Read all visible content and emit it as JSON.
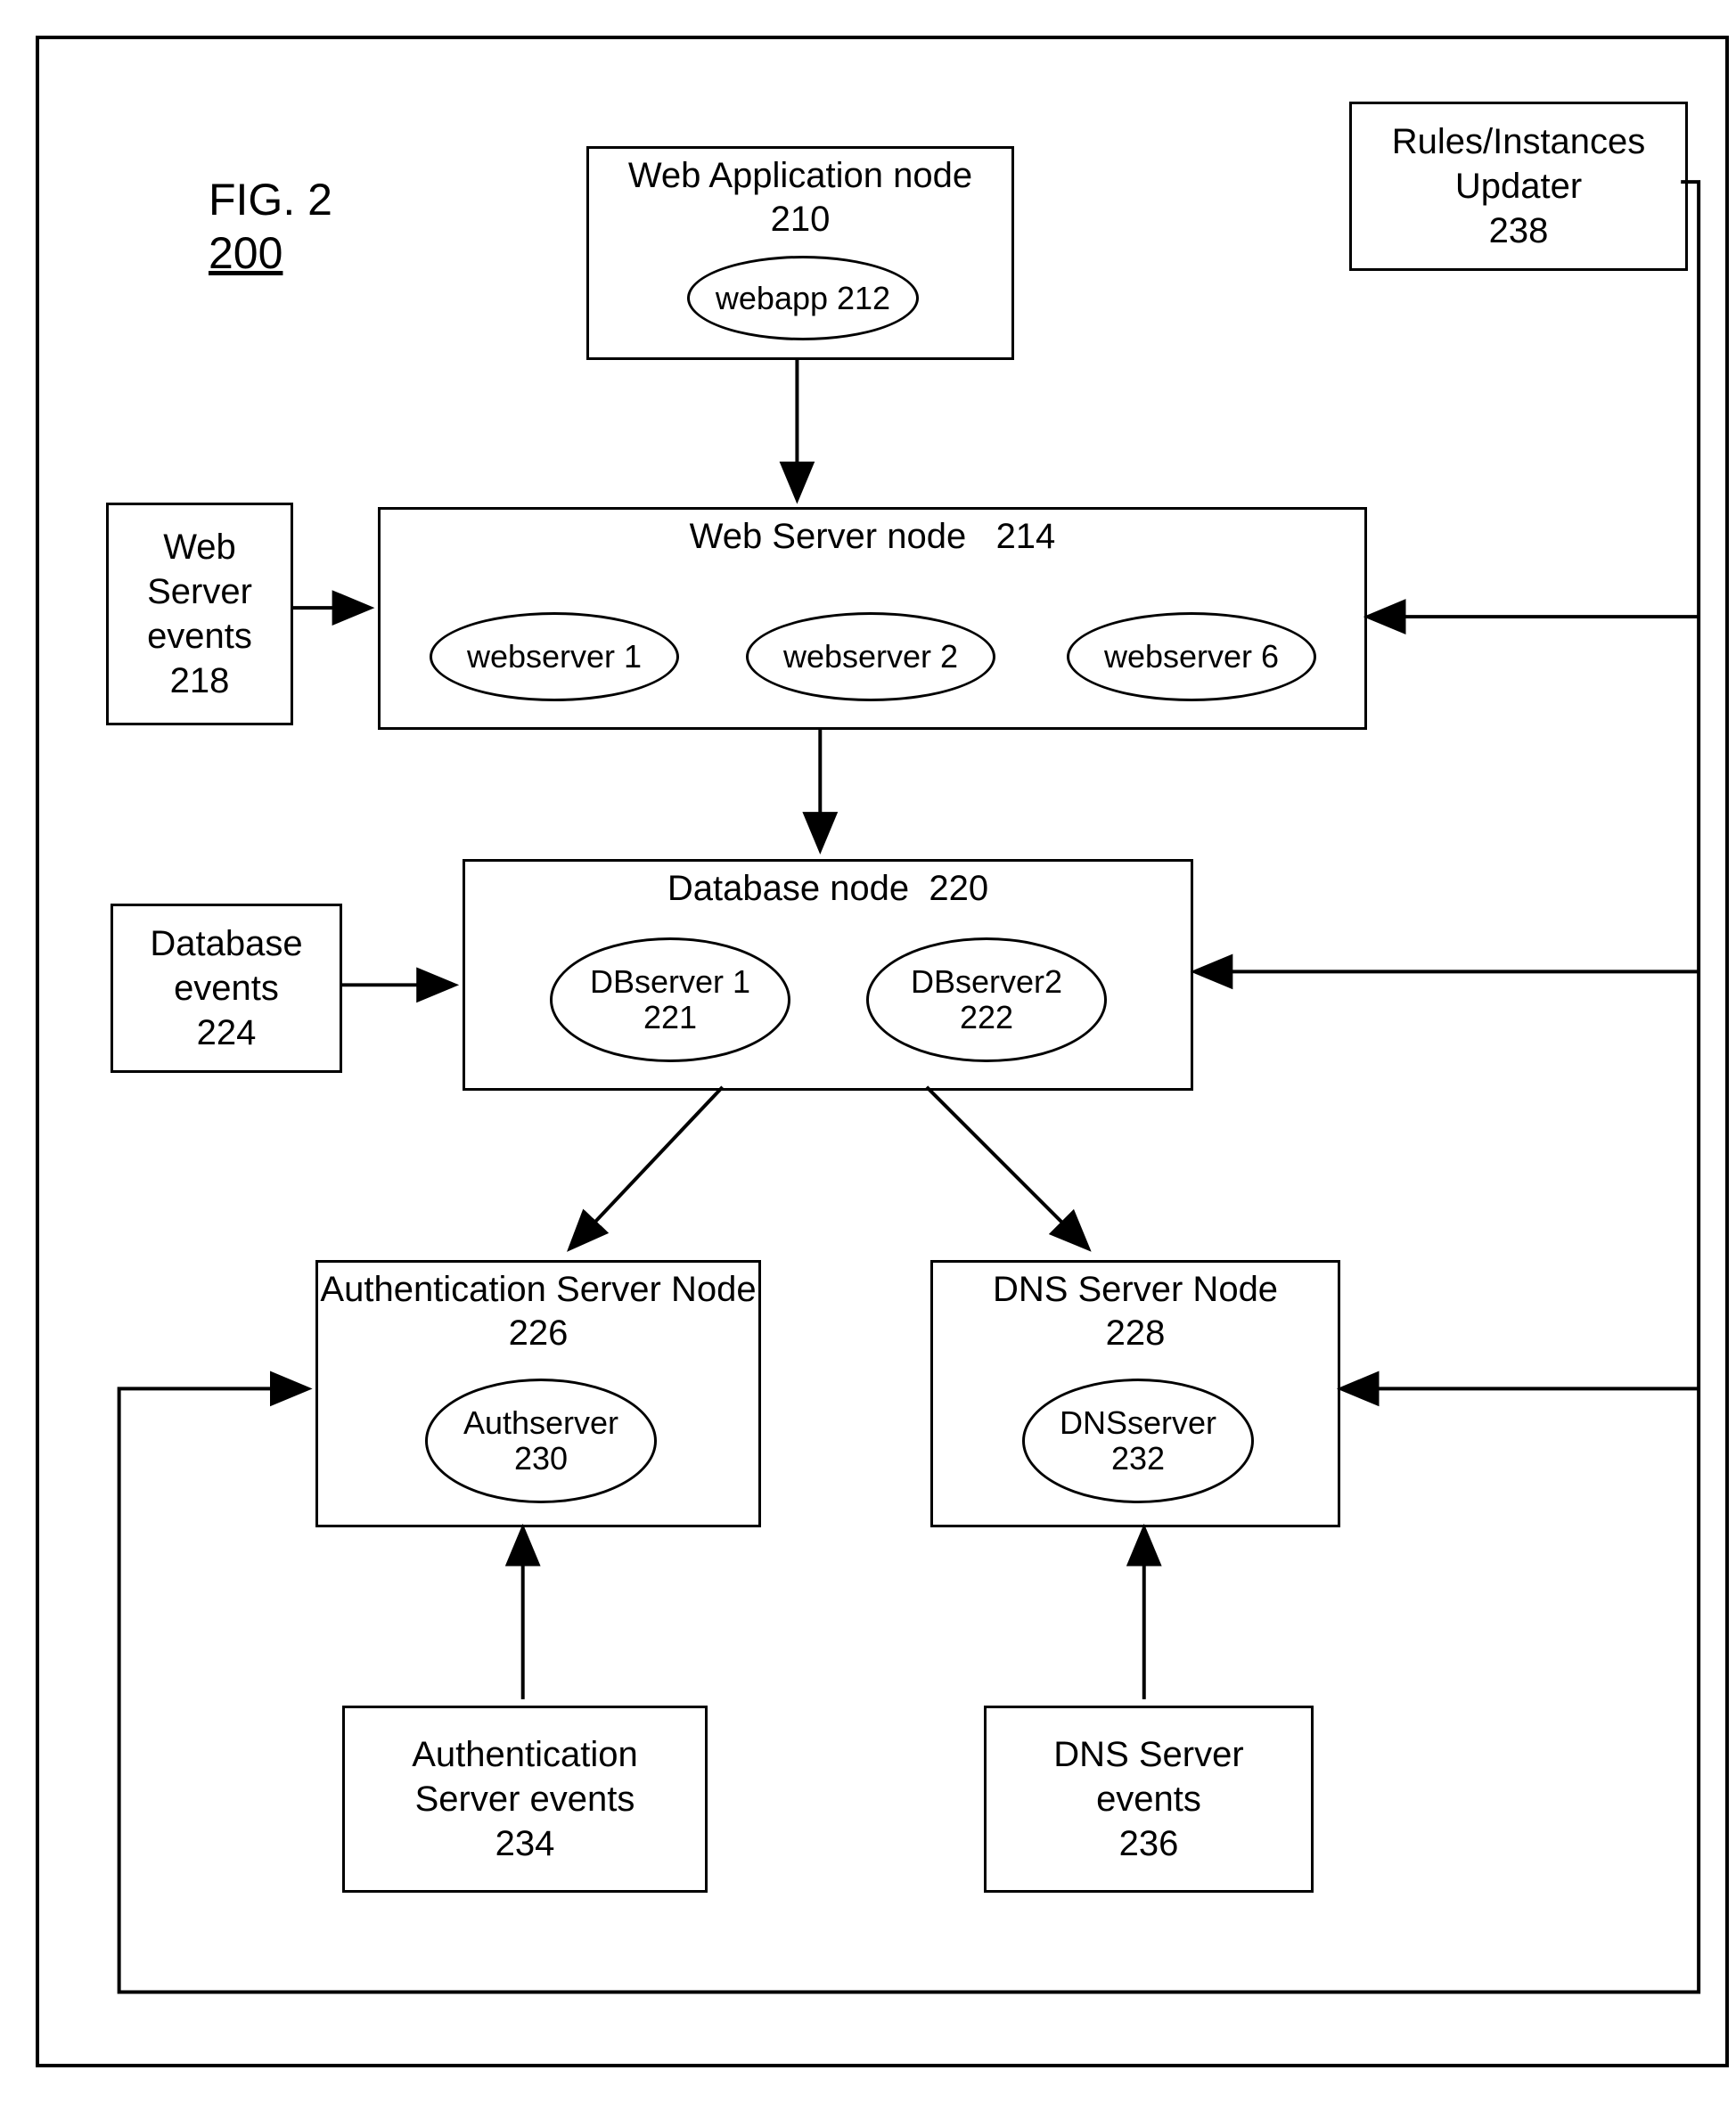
{
  "figure": {
    "label_line1": "FIG. 2",
    "label_line2": "200"
  },
  "updater": {
    "name": "Rules/Instances Updater",
    "ref": "238"
  },
  "webapp_node": {
    "title": "Web Application node",
    "ref": "210",
    "instance": "webapp 212"
  },
  "webserver_node": {
    "title": "Web Server node",
    "ref": "214",
    "instances": [
      "webserver 1",
      "webserver 2",
      "webserver 6"
    ]
  },
  "webserver_events": {
    "name": "Web Server events",
    "ref": "218"
  },
  "db_node": {
    "title": "Database node",
    "ref": "220",
    "instances": [
      {
        "label": "DBserver 1",
        "ref": "221"
      },
      {
        "label": "DBserver2",
        "ref": "222"
      }
    ]
  },
  "db_events": {
    "name": "Database events",
    "ref": "224"
  },
  "auth_node": {
    "title": "Authentication Server Node",
    "ref": "226",
    "instance_label": "Authserver",
    "instance_ref": "230"
  },
  "dns_node": {
    "title": "DNS Server Node",
    "ref": "228",
    "instance_label": "DNSserver",
    "instance_ref": "232"
  },
  "auth_events": {
    "name": "Authentication Server events",
    "ref": "234"
  },
  "dns_events": {
    "name": "DNS Server events",
    "ref": "236"
  }
}
